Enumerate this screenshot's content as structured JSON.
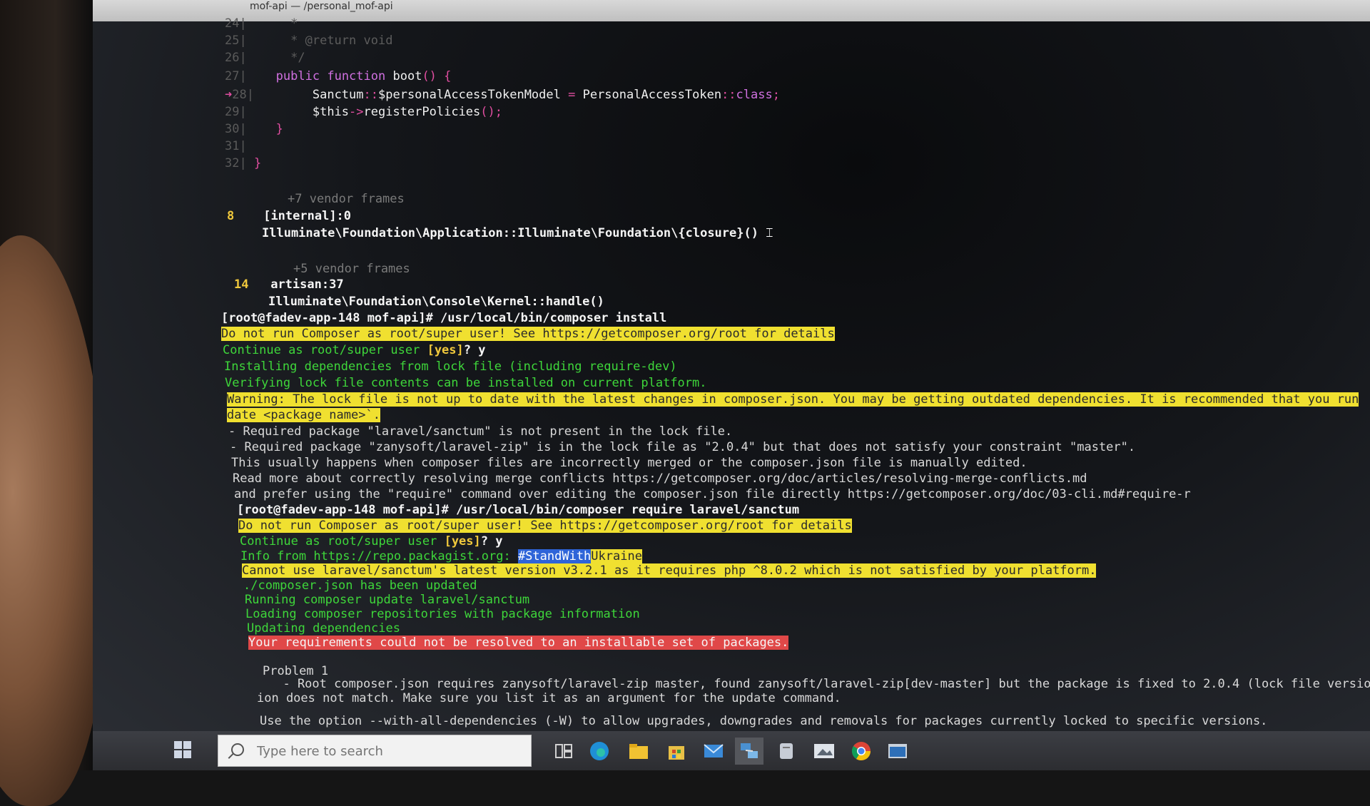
{
  "window": {
    "title": "mof-api — /personal_mof-api"
  },
  "terminal": {
    "code": {
      "line24": {
        "no": "24|",
        "text": "*"
      },
      "line25": {
        "no": "25|",
        "text": "* @return void"
      },
      "line26": {
        "no": "26|",
        "text": "*/"
      },
      "line27": {
        "no": "27|",
        "kw1": "public",
        "kw2": "function",
        "name": "boot",
        "paren": "()",
        "brace": "{"
      },
      "line28": {
        "no": "28|",
        "marker": "➜",
        "cls": "Sanctum",
        "sep": "::",
        "prop": "$personalAccessTokenModel",
        "eq": " = ",
        "cls2": "PersonalAccessToken",
        "sep2": "::",
        "kw": "class",
        "semi": ";"
      },
      "line29": {
        "no": "29|",
        "this": "$this",
        "arrow": "->",
        "method": "registerPolicies",
        "paren": "();"
      },
      "line30": {
        "no": "30|",
        "brace": "}"
      },
      "line31": {
        "no": "31|"
      },
      "line32": {
        "no": "32|",
        "brace": "}"
      }
    },
    "trace": {
      "vendor7": "+7 vendor frames",
      "frame8_num": "8",
      "frame8_file": "[internal]:0",
      "frame8_call": "Illuminate\\Foundation\\Application::Illuminate\\Foundation\\{closure}(",
      "frame8_close": ")",
      "vendor5": "+5 vendor frames",
      "frame14_num": "14",
      "frame14_file": "artisan:37",
      "frame14_call": "Illuminate\\Foundation\\Console\\Kernel::handle()"
    },
    "output": {
      "prompt1": "[root@fadev-app-148 mof-api]# /usr/local/bin/composer install",
      "warn_root1": "Do not run Composer as root/super user! See https://getcomposer.org/root for details",
      "continue1_a": "Continue as root/super user ",
      "continue1_b": "[yes]",
      "continue1_c": "? y",
      "installing": "Installing dependencies from lock file (including require-dev)",
      "verifying": "Verifying lock file contents can be installed on current platform.",
      "warning_a": "Warning: The lock file is not up to date with the latest changes in composer.json. You may be getting outdated dependencies. It is recommended that you run",
      "warning_b": "date <package name>`.",
      "req_sanctum": "- Required package \"laravel/sanctum\" is not present in the lock file.",
      "req_zip": "- Required package \"zanysoft/laravel-zip\" is in the lock file as \"2.0.4\" but that does not satisfy your constraint \"master\".",
      "usually": "This usually happens when composer files are incorrectly merged or the composer.json file is manually edited.",
      "readmore": "Read more about correctly resolving merge conflicts https://getcomposer.org/doc/articles/resolving-merge-conflicts.md",
      "prefer": "and prefer using the \"require\" command over editing the composer.json file directly https://getcomposer.org/doc/03-cli.md#require-r",
      "prompt2": "[root@fadev-app-148 mof-api]# /usr/local/bin/composer require laravel/sanctum",
      "warn_root2": "Do not run Composer as root/super user! See https://getcomposer.org/root for details",
      "continue2_a": "Continue as root/super user ",
      "continue2_b": "[yes]",
      "continue2_c": "? y",
      "info_a": "Info from https://repo.packagist.org: ",
      "info_b": "#StandWith",
      "info_c": "Ukraine",
      "cannot": "Cannot use laravel/sanctum's latest version v3.2.1 as it requires php ^8.0.2 which is not satisfied by your platform.",
      "updated": "./composer.json has been updated",
      "running": "Running composer update laravel/sanctum",
      "loading": "Loading composer repositories with package information",
      "updating": "Updating dependencies",
      "error": "Your requirements could not be resolved to an installable set of packages.",
      "problem": "Problem 1",
      "root_req": "  - Root composer.json requires zanysoft/laravel-zip master, found zanysoft/laravel-zip[dev-master] but the package is fixed to 2.0.4 (lock file version) by a",
      "ion": "ion does not match. Make sure you list it as an argument for the update command.",
      "use_option": "Use the option --with-all-dependencies (-W) to allow upgrades, downgrades and removals for packages currently locked to specific versions."
    }
  },
  "taskbar": {
    "search_placeholder": "Type here to search",
    "icons": [
      "windows-icon",
      "task-view-icon",
      "edge-icon",
      "file-explorer-icon",
      "store-icon",
      "mail-icon",
      "network-app-icon",
      "notes-app-icon",
      "media-app-icon",
      "chrome-icon",
      "terminal-app-icon"
    ]
  },
  "colors": {
    "yellow_highlight": "#f0e030",
    "red_highlight": "#e04848",
    "green_text": "#3ed63a",
    "keyword": "#d070e0"
  }
}
